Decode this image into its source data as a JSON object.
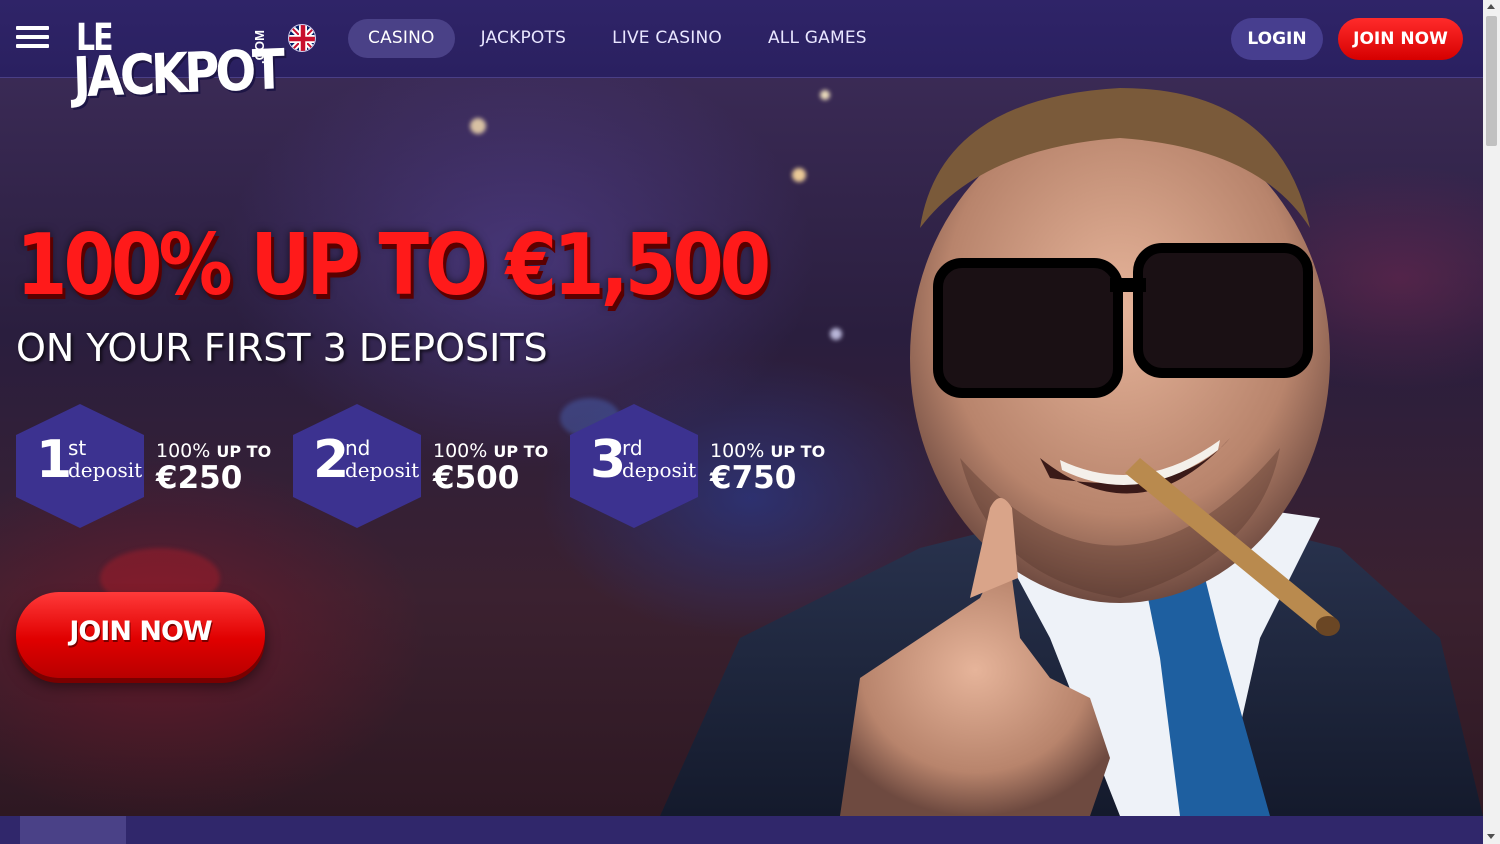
{
  "header": {
    "menu_icon": "hamburger-icon",
    "logo": {
      "line1": "LE",
      "line2": "JACKPOT",
      "suffix": ".COM"
    },
    "language_icon": "uk-flag-icon",
    "nav": [
      {
        "label": "CASINO",
        "active": true
      },
      {
        "label": "JACKPOTS",
        "active": false
      },
      {
        "label": "LIVE CASINO",
        "active": false
      },
      {
        "label": "ALL GAMES",
        "active": false
      }
    ],
    "login_label": "LOGIN",
    "join_label": "JOIN NOW"
  },
  "hero": {
    "title": "100% UP TO €1,500",
    "subtitle": "ON YOUR FIRST 3 DEPOSITS",
    "deposits": [
      {
        "number": "1",
        "suffix": "st",
        "label": "deposit",
        "percent": "100%",
        "upto": "UP TO",
        "amount": "€250"
      },
      {
        "number": "2",
        "suffix": "nd",
        "label": "deposit",
        "percent": "100%",
        "upto": "UP TO",
        "amount": "€500"
      },
      {
        "number": "3",
        "suffix": "rd",
        "label": "deposit",
        "percent": "100%",
        "upto": "UP TO",
        "amount": "€750"
      }
    ],
    "cta_label": "JOIN NOW"
  },
  "colors": {
    "header_bg": "#2f2468",
    "accent_red": "#ff1a1a",
    "hex_bg": "#3c3290",
    "nav_active_bg": "#4a4187",
    "login_bg": "#473e8f"
  }
}
